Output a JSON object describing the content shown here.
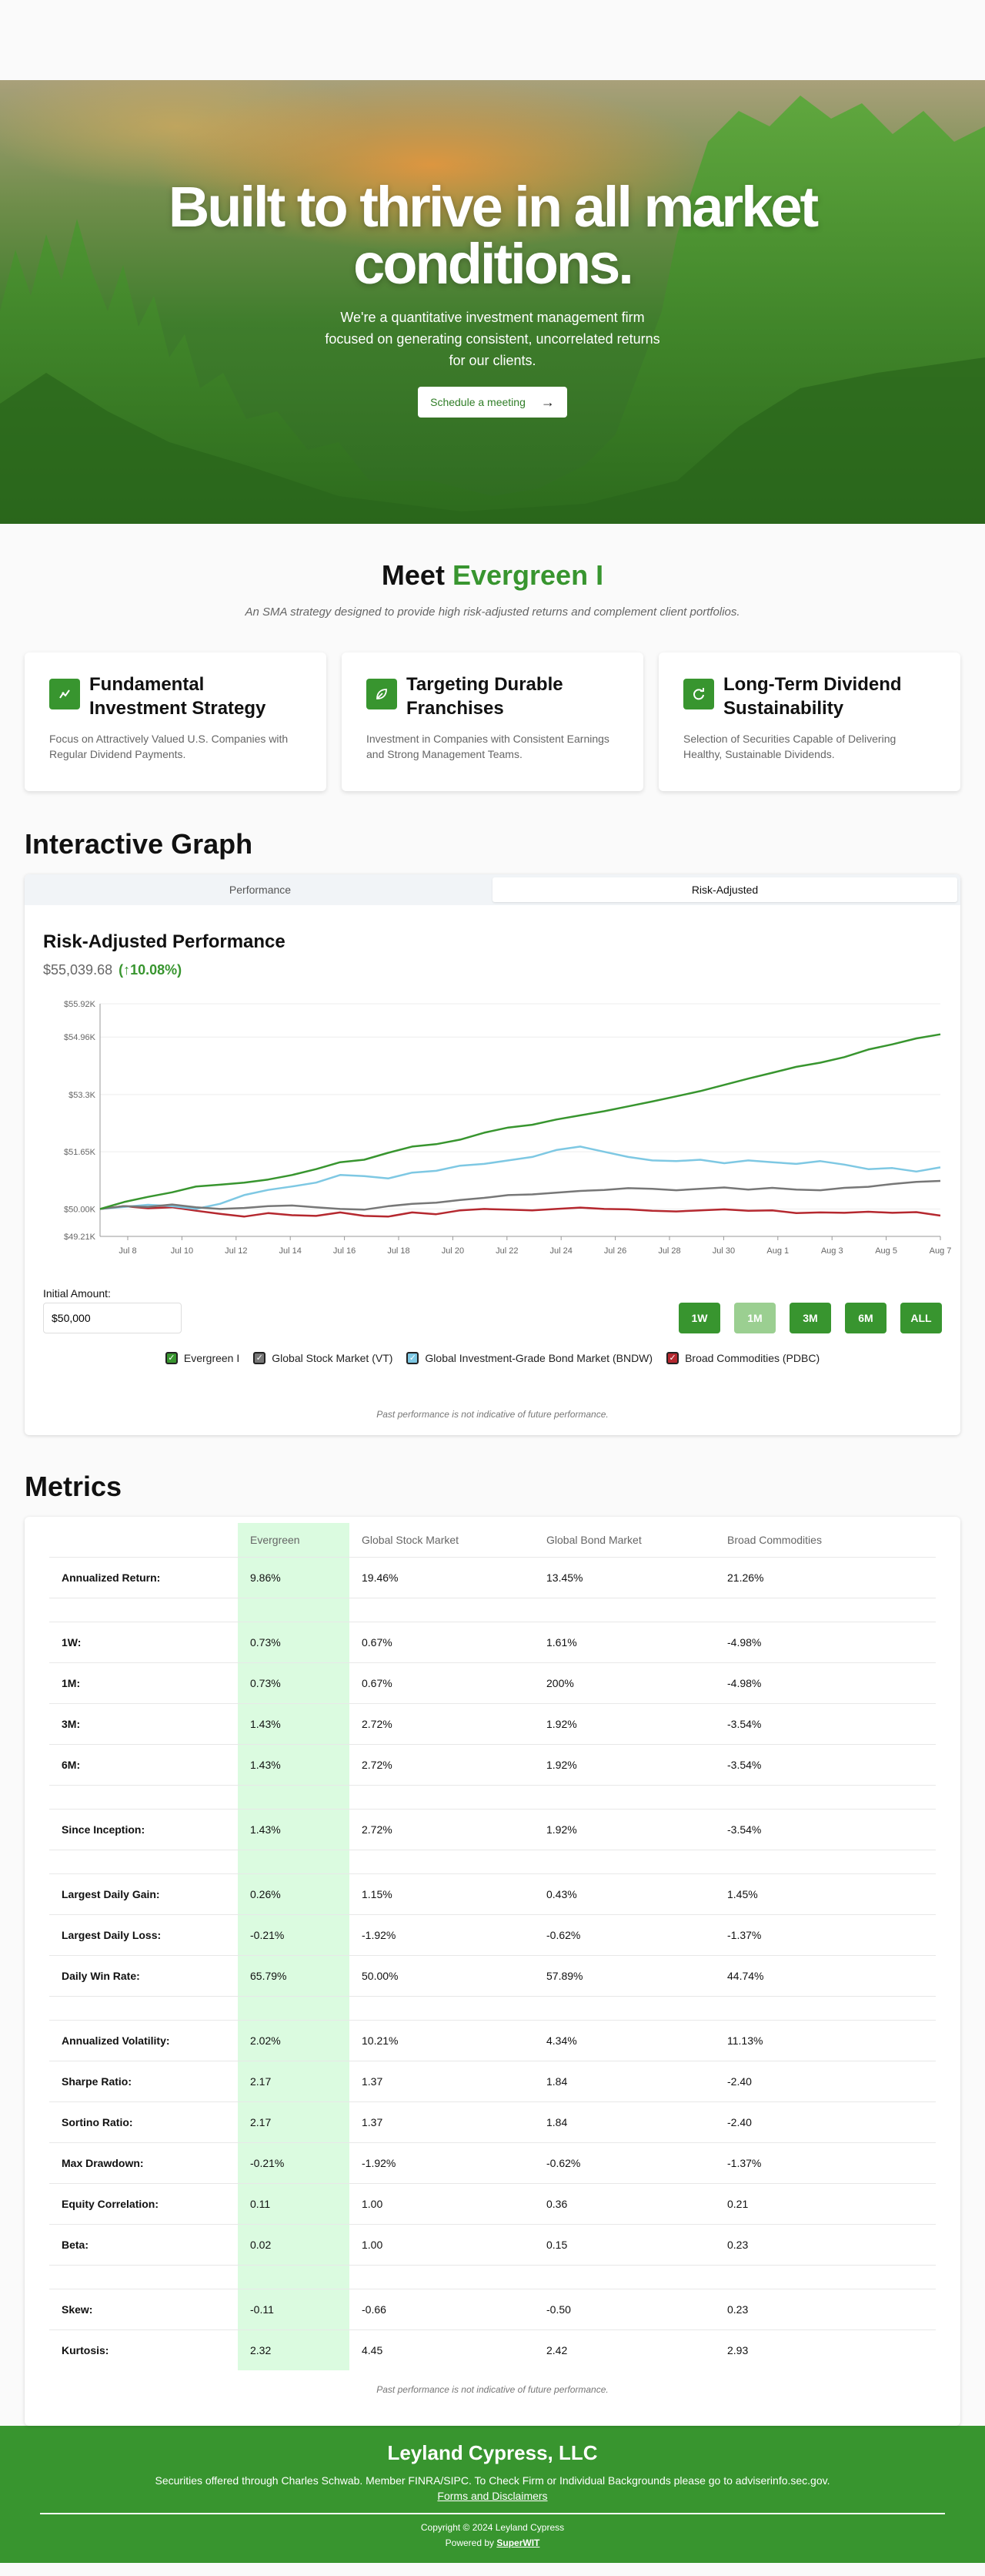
{
  "hero": {
    "title": "Built to thrive in all market conditions.",
    "subtitle": "We're a quantitative investment management firm focused on generating consistent, uncorrelated returns for our clients.",
    "cta_label": "Schedule a meeting",
    "cta_icon": "arrow-right-icon"
  },
  "meet": {
    "title_prefix": "Meet",
    "title_highlight": "Evergreen I",
    "subtitle": "An SMA strategy designed to provide high risk-adjusted returns and complement client portfolios."
  },
  "features": [
    {
      "icon": "chart-icon",
      "title": "Fundamental Investment Strategy",
      "text": "Focus on Attractively Valued U.S. Companies with Regular Dividend Payments."
    },
    {
      "icon": "leaf-icon",
      "title": "Targeting Durable Franchises",
      "text": "Investment in Companies with Consistent Earnings and Strong Management Teams."
    },
    {
      "icon": "refresh-icon",
      "title": "Long-Term Dividend Sustainability",
      "text": "Selection of Securities Capable of Delivering Healthy, Sustainable Dividends."
    }
  ],
  "graph": {
    "section_title": "Interactive Graph",
    "tabs": [
      "Performance",
      "Risk-Adjusted"
    ],
    "active_tab": "Risk-Adjusted",
    "title": "Risk-Adjusted Performance",
    "value": "$55,039.68",
    "change": "(↑10.08%)",
    "initial_amount_label": "Initial Amount:",
    "initial_amount_value": "$50,000",
    "ranges": [
      "1W",
      "1M",
      "3M",
      "6M",
      "ALL"
    ],
    "selected_range": "1M",
    "disclaimer": "Past performance is not indicative of future performance."
  },
  "chart_data": {
    "type": "line",
    "title": "Risk-Adjusted Performance",
    "xlabel": "",
    "ylabel": "",
    "ylim": [
      49210,
      55920
    ],
    "yticks": [
      "$49.21K",
      "$50.00K",
      "$51.65K",
      "$53.3K",
      "$54.96K",
      "$55.92K"
    ],
    "ytick_values": [
      49210,
      50000,
      51650,
      53300,
      54960,
      55920
    ],
    "xticks": [
      "Jul 8",
      "Jul 10",
      "Jul 12",
      "Jul 14",
      "Jul 16",
      "Jul 18",
      "Jul 20",
      "Jul 22",
      "Jul 24",
      "Jul 26",
      "Jul 28",
      "Jul 30",
      "Aug 1",
      "Aug 3",
      "Aug 5",
      "Aug 7"
    ],
    "grid": true,
    "legend_position": "bottom",
    "series": [
      {
        "name": "Evergreen I",
        "color": "#38952f",
        "values": [
          50000,
          50200,
          50350,
          50480,
          50650,
          50700,
          50760,
          50850,
          50980,
          51150,
          51350,
          51420,
          51620,
          51800,
          51870,
          52000,
          52200,
          52350,
          52430,
          52580,
          52700,
          52820,
          52960,
          53100,
          53250,
          53400,
          53580,
          53760,
          53930,
          54100,
          54220,
          54380,
          54600,
          54750,
          54920,
          55039
        ]
      },
      {
        "name": "Global Stock Market (VT)",
        "color": "#777777",
        "values": [
          50000,
          50080,
          50060,
          50130,
          50050,
          50000,
          50030,
          50080,
          50100,
          50050,
          50000,
          49980,
          50080,
          50150,
          50180,
          50260,
          50320,
          50400,
          50420,
          50470,
          50520,
          50550,
          50600,
          50580,
          50540,
          50580,
          50620,
          50560,
          50610,
          50560,
          50540,
          50610,
          50640,
          50720,
          50780,
          50810
        ]
      },
      {
        "name": "Global Investment-Grade Bond Market (BNDW)",
        "color": "#7ec8e3",
        "values": [
          50000,
          50060,
          50120,
          50080,
          50000,
          50150,
          50400,
          50550,
          50650,
          50760,
          50980,
          50950,
          50880,
          51050,
          51100,
          51250,
          51300,
          51400,
          51500,
          51700,
          51800,
          51650,
          51500,
          51400,
          51380,
          51420,
          51320,
          51400,
          51350,
          51300,
          51380,
          51280,
          51150,
          51180,
          51080,
          51200
        ]
      },
      {
        "name": "Broad Commodities (PDBC)",
        "color": "#b5282f",
        "values": [
          50000,
          50080,
          50020,
          50050,
          49950,
          49860,
          49780,
          49880,
          49820,
          49800,
          49900,
          49800,
          49780,
          49900,
          49850,
          49960,
          50000,
          49980,
          49960,
          50000,
          50040,
          50000,
          49990,
          49950,
          49930,
          49960,
          49990,
          49950,
          49960,
          49880,
          49900,
          49890,
          49920,
          49890,
          49910,
          49810
        ]
      }
    ]
  },
  "metrics": {
    "section_title": "Metrics",
    "columns": [
      "",
      "Evergreen",
      "Global Stock Market",
      "Global Bond Market",
      "Broad Commodities"
    ],
    "rows": [
      {
        "label": "Annualized Return:",
        "values": [
          "9.86%",
          "19.46%",
          "13.45%",
          "21.26%"
        ]
      },
      {
        "gap": true
      },
      {
        "label": "1W:",
        "values": [
          "0.73%",
          "0.67%",
          "1.61%",
          "-4.98%"
        ]
      },
      {
        "label": "1M:",
        "values": [
          "0.73%",
          "0.67%",
          "200%",
          "-4.98%"
        ]
      },
      {
        "label": "3M:",
        "values": [
          "1.43%",
          "2.72%",
          "1.92%",
          "-3.54%"
        ]
      },
      {
        "label": "6M:",
        "values": [
          "1.43%",
          "2.72%",
          "1.92%",
          "-3.54%"
        ]
      },
      {
        "gap": true
      },
      {
        "label": "Since Inception:",
        "values": [
          "1.43%",
          "2.72%",
          "1.92%",
          "-3.54%"
        ]
      },
      {
        "gap": true
      },
      {
        "label": "Largest Daily Gain:",
        "values": [
          "0.26%",
          "1.15%",
          "0.43%",
          "1.45%"
        ]
      },
      {
        "label": "Largest Daily Loss:",
        "values": [
          "-0.21%",
          "-1.92%",
          "-0.62%",
          "-1.37%"
        ]
      },
      {
        "label": "Daily Win Rate:",
        "values": [
          "65.79%",
          "50.00%",
          "57.89%",
          "44.74%"
        ]
      },
      {
        "gap": true
      },
      {
        "label": "Annualized Volatility:",
        "values": [
          "2.02%",
          "10.21%",
          "4.34%",
          "11.13%"
        ]
      },
      {
        "label": "Sharpe Ratio:",
        "values": [
          "2.17",
          "1.37",
          "1.84",
          "-2.40"
        ]
      },
      {
        "label": "Sortino Ratio:",
        "values": [
          "2.17",
          "1.37",
          "1.84",
          "-2.40"
        ]
      },
      {
        "label": "Max Drawdown:",
        "values": [
          "-0.21%",
          "-1.92%",
          "-0.62%",
          "-1.37%"
        ]
      },
      {
        "label": "Equity Correlation:",
        "values": [
          "0.11",
          "1.00",
          "0.36",
          "0.21"
        ]
      },
      {
        "label": "Beta:",
        "values": [
          "0.02",
          "1.00",
          "0.15",
          "0.23"
        ]
      },
      {
        "gap": true
      },
      {
        "label": "Skew:",
        "values": [
          "-0.11",
          "-0.66",
          "-0.50",
          "0.23"
        ]
      },
      {
        "label": "Kurtosis:",
        "values": [
          "2.32",
          "4.45",
          "2.42",
          "2.93"
        ]
      }
    ],
    "disclaimer": "Past performance is not indicative of future performance."
  },
  "footer": {
    "company": "Leyland Cypress, LLC",
    "line1": "Securities offered through Charles Schwab. Member FINRA/SIPC. To Check Firm or Individual Backgrounds please go to adviserinfo.sec.gov.",
    "link": "Forms and Disclaimers",
    "copyright": "Copyright © 2024 Leyland Cypress",
    "powered_prefix": "Powered by",
    "powered_brand": "SuperWIT"
  },
  "colors": {
    "accent": "#38952f",
    "evergreen_highlight": "#dbfbe0"
  }
}
